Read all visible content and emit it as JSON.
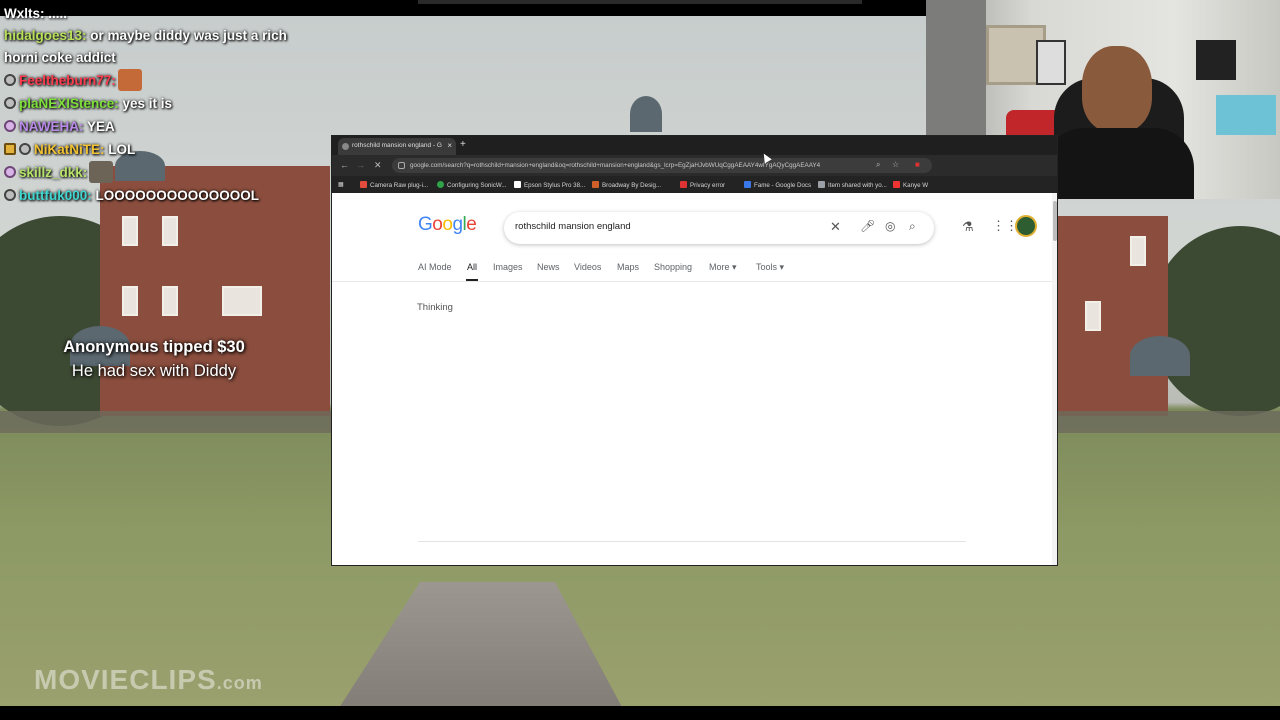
{
  "chat": {
    "top_partial": "Wxlts: .....",
    "messages": [
      {
        "user": "hidalgoes13:",
        "user_color": "#b9e05a",
        "text": " or maybe diddy was just a rich horni coke addict",
        "badge": "none"
      },
      {
        "user": "Feeltheburn77:",
        "user_color": "#ff3b4e",
        "text": "",
        "badge": "circle",
        "emote": "emote-face"
      },
      {
        "user": "plaNEXIStence:",
        "user_color": "#7ee03a",
        "text": " yes it is",
        "badge": "circle"
      },
      {
        "user": "NAWEHA:",
        "user_color": "#b98ae8",
        "text": " YEA",
        "badge": "pink"
      },
      {
        "user": "NiKatNiTE:",
        "user_color": "#f2c232",
        "text": " LOL",
        "badge": "gold2"
      },
      {
        "user": "skillz_dkk:",
        "user_color": "#b7e36a",
        "text": "",
        "badge": "pink",
        "emote": "emote-gray"
      },
      {
        "user": "buttfuk000:",
        "user_color": "#3fd7d0",
        "text": " LOOOOOOOOOOOOOOL",
        "badge": "circle"
      }
    ]
  },
  "tip": {
    "title": "Anonymous tipped $30",
    "message": "He had sex with Diddy"
  },
  "browser": {
    "tab_title": "rothschild mansion england - G",
    "new_tab_symbol": "+",
    "close_symbol": "×",
    "url": "google.com/search?q=rothschild+mansion+england&oq=rothschild+mansion+england&gs_lcrp=EgZjaHJvbWUqCggAEAAY4wIYgAQyCggAEAAY4",
    "bookmarks": [
      "Camera Raw plug-i...",
      "Configuring SonicW...",
      "Epson Stylus Pro 38...",
      "Broadway By Desig...",
      "Privacy error",
      "Fame - Google Docs",
      "Item shared with yo...",
      "Kanye W"
    ],
    "bookmark_colors": [
      "#e34c3c",
      "#2fa34a",
      "#ffffff",
      "#d0602a",
      "#d33",
      "#3b78e7",
      "#9aa0a6",
      "#e33"
    ]
  },
  "google": {
    "logo": [
      {
        "ch": "G",
        "color": "#4285f4"
      },
      {
        "ch": "o",
        "color": "#ea4335"
      },
      {
        "ch": "o",
        "color": "#fbbc05"
      },
      {
        "ch": "g",
        "color": "#4285f4"
      },
      {
        "ch": "l",
        "color": "#34a853"
      },
      {
        "ch": "e",
        "color": "#ea4335"
      }
    ],
    "query": "rothschild mansion england",
    "tabs": [
      "AI Mode",
      "All",
      "Images",
      "News",
      "Videos",
      "Maps",
      "Shopping",
      "More ▾",
      "Tools ▾"
    ],
    "active_tab": "All",
    "status": "Thinking"
  },
  "watermark": {
    "main": "MOVIECLIPS",
    "suffix": ".com"
  }
}
